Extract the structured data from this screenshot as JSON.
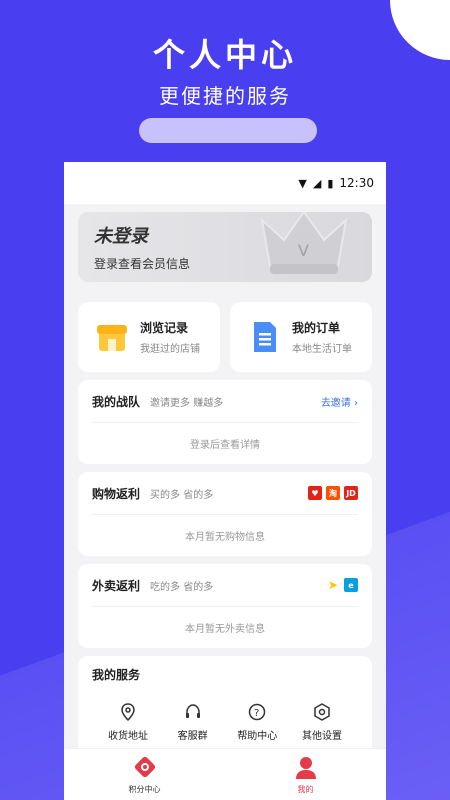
{
  "promo": {
    "title": "个人中心",
    "subtitle": "更便捷的服务"
  },
  "status_bar": {
    "time": "12:30",
    "icons": [
      "wifi-icon",
      "signal-icon",
      "battery-icon"
    ]
  },
  "login": {
    "title": "未登录",
    "subtitle": "登录查看会员信息"
  },
  "quick": [
    {
      "title": "浏览记录",
      "subtitle": "我逛过的店铺",
      "icon": "shop-icon"
    },
    {
      "title": "我的订单",
      "subtitle": "本地生活订单",
      "icon": "document-icon"
    }
  ],
  "team": {
    "title": "我的战队",
    "hint": "邀请更多 赚越多",
    "link": "去邀请 ›",
    "empty": "登录后查看详情"
  },
  "shopping": {
    "title": "购物返利",
    "hint": "买的多 省的多",
    "empty": "本月暂无购物信息",
    "badges": [
      "",
      "",
      "JD"
    ]
  },
  "takeout": {
    "title": "外卖返利",
    "hint": "吃的多 省的多",
    "empty": "本月暂无外卖信息"
  },
  "services": {
    "title": "我的服务",
    "items": [
      {
        "label": "收货地址",
        "icon": "location-icon"
      },
      {
        "label": "客服群",
        "icon": "headset-icon"
      },
      {
        "label": "帮助中心",
        "icon": "help-icon"
      },
      {
        "label": "其他设置",
        "icon": "settings-icon"
      }
    ]
  },
  "tabs": [
    {
      "label": "积分中心",
      "icon": "points-icon"
    },
    {
      "label": "我的",
      "icon": "profile-icon"
    }
  ],
  "colors": {
    "background": "#4a3ff0",
    "accent_red": "#e43b4b",
    "link_blue": "#3a6ef0"
  }
}
